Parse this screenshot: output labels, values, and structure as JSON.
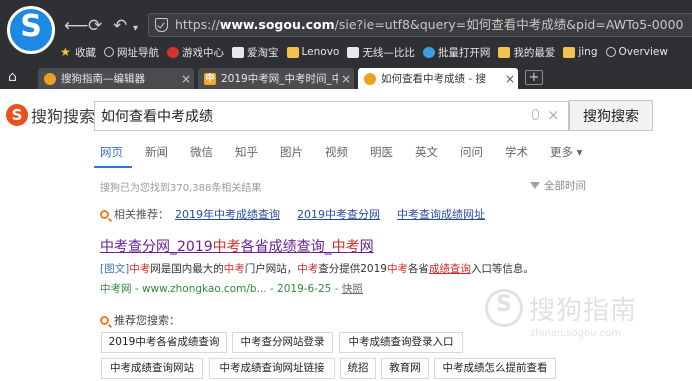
{
  "browser": {
    "address": {
      "prefix": "https://",
      "domain": "www.sogou.com",
      "path": "/sie?ie=utf8&query=如何查看中考成绩&pid=AWTo5-0000"
    },
    "bookmarks": [
      {
        "label": "收藏",
        "icon": "star-icon"
      },
      {
        "label": "网址导航",
        "icon": "globe-icon"
      },
      {
        "label": "游戏中心",
        "icon": "game-icon"
      },
      {
        "label": "爱淘宝",
        "icon": "page-icon"
      },
      {
        "label": "Lenovo",
        "icon": "folder-icon"
      },
      {
        "label": "无线—比比",
        "icon": "page-icon"
      },
      {
        "label": "批量打开网",
        "icon": "download-icon"
      },
      {
        "label": "我的最爱",
        "icon": "folder-icon"
      },
      {
        "label": "jing",
        "icon": "folder-icon"
      },
      {
        "label": "Overview",
        "icon": "globe-icon"
      }
    ],
    "tabs": [
      {
        "title": "搜狗指南—编辑器"
      },
      {
        "title": "2019中考网_中考时间_中"
      },
      {
        "title": "如何查看中考成绩 - 搜"
      }
    ]
  },
  "page": {
    "brand": "搜狗搜索",
    "query": "如何查看中考成绩",
    "search_button": "搜狗搜索",
    "nav": [
      "网页",
      "新闻",
      "微信",
      "知乎",
      "图片",
      "视频",
      "明医",
      "英文",
      "问问",
      "学术",
      "更多"
    ],
    "nav_more_arrow": "▾",
    "result_count": "搜狗已为您找到370,388条相关结果",
    "time_filter": "全部时间",
    "related": {
      "label": "相关推荐：",
      "items": [
        "2019年中考成绩查询",
        "2019中考查分网",
        "中考查询成绩网址"
      ]
    },
    "result": {
      "title_parts": [
        "中考查分网_2019",
        "中考",
        "各省成绩查询_",
        "中考",
        "网"
      ],
      "desc_parts": [
        "[图文]",
        "中考",
        "网是国内最大的",
        "中考",
        "门户网站，",
        "中考",
        "查分提供2019",
        "中考",
        "各省",
        "成绩查询",
        "入口等信息。"
      ],
      "meta": "中考网 - www.zhongkao.com/b... - 2019-6-25 - ",
      "snapshot": "快照"
    },
    "recommend": {
      "label": "推荐您搜索：",
      "chips": [
        "2019中考各省成绩查询",
        "中考查分网站登录",
        "中考成绩查询登录入口",
        "中考成绩查询网站",
        "中考成绩查询网址链接",
        "统招",
        "教育网",
        "中考成绩怎么提前查看"
      ]
    },
    "watermark": {
      "text": "搜狗指南",
      "url": "zhinan.sogou.com"
    }
  }
}
